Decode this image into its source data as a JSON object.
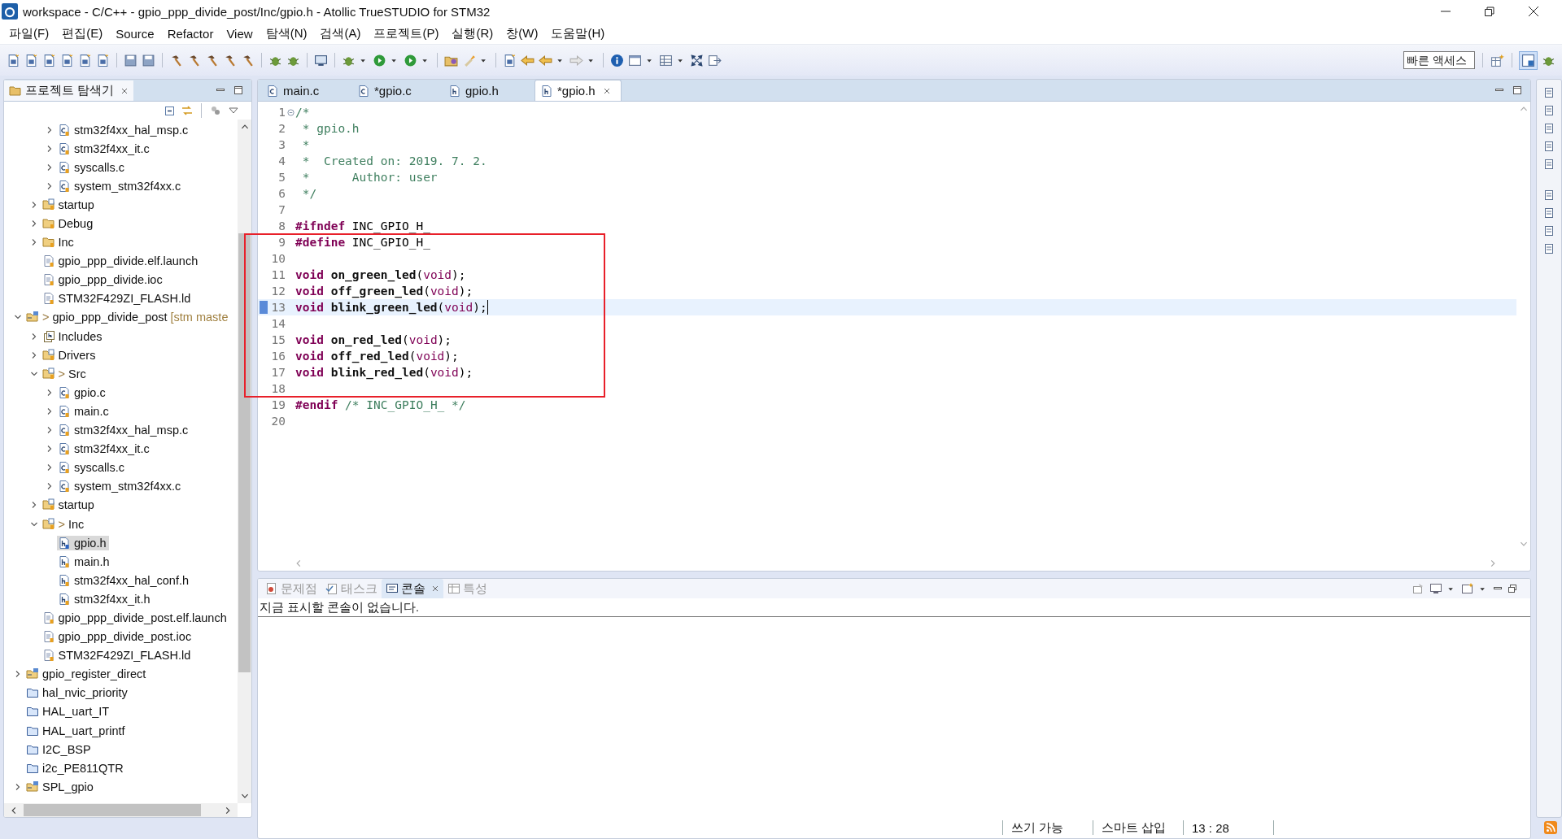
{
  "window": {
    "title": "workspace - C/C++ - gpio_ppp_divide_post/Inc/gpio.h - Atollic TrueSTUDIO for STM32"
  },
  "menu": [
    "파일(F)",
    "편집(E)",
    "Source",
    "Refactor",
    "View",
    "탐색(N)",
    "검색(A)",
    "프로젝트(P)",
    "실행(R)",
    "창(W)",
    "도움말(H)"
  ],
  "quick_access": {
    "placeholder": "빠른 액세스"
  },
  "explorer": {
    "title": "프로젝트 탐색기",
    "items": [
      {
        "children": [
          {
            "children": [
              {
                "label": "stm32f4xx_hal_msp.c",
                "kind": "c-file",
                "expanded": false,
                "selected": false
              },
              {
                "label": "stm32f4xx_it.c",
                "kind": "c-file",
                "expanded": false,
                "selected": false
              },
              {
                "label": "syscalls.c",
                "kind": "c-file",
                "expanded": false,
                "selected": false
              },
              {
                "label": "system_stm32f4xx.c",
                "kind": "c-file",
                "expanded": false,
                "selected": false
              }
            ]
          },
          {
            "label": "startup",
            "kind": "src-folder",
            "expanded": false,
            "selected": false
          },
          {
            "label": "Debug",
            "kind": "folder",
            "expanded": false,
            "selected": false
          },
          {
            "label": "Inc",
            "kind": "folder",
            "expanded": false,
            "selected": false
          },
          {
            "label": "gpio_ppp_divide.elf.launch",
            "kind": "doc-file",
            "selected": false
          },
          {
            "label": "gpio_ppp_divide.ioc",
            "kind": "doc-file",
            "selected": false
          },
          {
            "label": "STM32F429ZI_FLASH.ld",
            "kind": "doc-file",
            "selected": false
          }
        ]
      },
      {
        "label": "gpio_ppp_divide_post",
        "prefix": ">",
        "suffix": "[stm maste",
        "kind": "project",
        "expanded": true,
        "selected": false,
        "children": [
          {
            "label": "Includes",
            "kind": "includes",
            "expanded": false,
            "selected": false
          },
          {
            "label": "Drivers",
            "kind": "src-folder",
            "expanded": false,
            "selected": false
          },
          {
            "label": "Src",
            "prefix": ">",
            "kind": "src-folder",
            "expanded": true,
            "selected": false,
            "children": [
              {
                "label": "gpio.c",
                "kind": "c-file",
                "expanded": false,
                "selected": false
              },
              {
                "label": "main.c",
                "kind": "c-file",
                "expanded": false,
                "selected": false
              },
              {
                "label": "stm32f4xx_hal_msp.c",
                "kind": "c-file",
                "expanded": false,
                "selected": false
              },
              {
                "label": "stm32f4xx_it.c",
                "kind": "c-file",
                "expanded": false,
                "selected": false
              },
              {
                "label": "syscalls.c",
                "kind": "c-file",
                "expanded": false,
                "selected": false
              },
              {
                "label": "system_stm32f4xx.c",
                "kind": "c-file",
                "expanded": false,
                "selected": false
              }
            ]
          },
          {
            "label": "startup",
            "kind": "src-folder",
            "expanded": false,
            "selected": false
          },
          {
            "label": "Inc",
            "prefix": ">",
            "kind": "src-folder",
            "expanded": true,
            "selected": false,
            "children": [
              {
                "label": "gpio.h",
                "kind": "h-file",
                "selected": true
              },
              {
                "label": "main.h",
                "kind": "h-file",
                "selected": false
              },
              {
                "label": "stm32f4xx_hal_conf.h",
                "kind": "h-file",
                "selected": false
              },
              {
                "label": "stm32f4xx_it.h",
                "kind": "h-file",
                "selected": false
              }
            ]
          },
          {
            "label": "gpio_ppp_divide_post.elf.launch",
            "kind": "doc-file",
            "selected": false
          },
          {
            "label": "gpio_ppp_divide_post.ioc",
            "kind": "doc-file",
            "selected": false
          },
          {
            "label": "STM32F429ZI_FLASH.ld",
            "kind": "doc-file",
            "selected": false
          }
        ]
      },
      {
        "label": "gpio_register_direct",
        "kind": "project",
        "expanded": false,
        "selected": false
      },
      {
        "label": "hal_nvic_priority",
        "kind": "closed-project",
        "selected": false
      },
      {
        "label": "HAL_uart_IT",
        "kind": "closed-project",
        "selected": false
      },
      {
        "label": "HAL_uart_printf",
        "kind": "closed-project",
        "selected": false
      },
      {
        "label": "I2C_BSP",
        "kind": "closed-project",
        "selected": false
      },
      {
        "label": "i2c_PE811QTR",
        "kind": "closed-project",
        "selected": false
      },
      {
        "label": "SPL_gpio",
        "kind": "project",
        "expanded": false,
        "selected": false
      }
    ]
  },
  "editor": {
    "tabs": [
      {
        "label": "main.c",
        "kind": "c",
        "selected": false
      },
      {
        "label": "*gpio.c",
        "kind": "c",
        "selected": false
      },
      {
        "label": "gpio.h",
        "kind": "h",
        "selected": false
      },
      {
        "label": "*gpio.h",
        "kind": "h",
        "selected": true
      }
    ],
    "lines": [
      {
        "number": "1",
        "fold": true,
        "current": false,
        "tokens": [
          {
            "kind": "comment",
            "text": "/*"
          }
        ]
      },
      {
        "number": "2",
        "fold": false,
        "current": false,
        "tokens": [
          {
            "kind": "comment",
            "text": " * gpio.h"
          }
        ]
      },
      {
        "number": "3",
        "fold": false,
        "current": false,
        "tokens": [
          {
            "kind": "comment",
            "text": " *"
          }
        ]
      },
      {
        "number": "4",
        "fold": false,
        "current": false,
        "tokens": [
          {
            "kind": "comment",
            "text": " *  Created on: 2019. 7. 2."
          }
        ]
      },
      {
        "number": "5",
        "fold": false,
        "current": false,
        "tokens": [
          {
            "kind": "comment",
            "text": " *      Author: user"
          }
        ]
      },
      {
        "number": "6",
        "fold": false,
        "current": false,
        "tokens": [
          {
            "kind": "comment",
            "text": " */"
          }
        ]
      },
      {
        "number": "7",
        "fold": false,
        "current": false
      },
      {
        "number": "8",
        "fold": false,
        "current": false,
        "tokens": [
          {
            "kind": "keyword",
            "text": "#ifndef"
          },
          {
            "kind": "plain",
            "text": " INC_GPIO_H_"
          }
        ]
      },
      {
        "number": "9",
        "fold": false,
        "current": false,
        "tokens": [
          {
            "kind": "keyword",
            "text": "#define"
          },
          {
            "kind": "plain",
            "text": " INC_GPIO_H_"
          }
        ]
      },
      {
        "number": "10",
        "fold": false,
        "current": false
      },
      {
        "number": "11",
        "fold": false,
        "current": false,
        "tokens": [
          {
            "kind": "keyword",
            "text": "void"
          },
          {
            "kind": "function",
            "text": " on_green_led"
          },
          {
            "kind": "plain",
            "text": "("
          },
          {
            "kind": "type",
            "text": "void"
          },
          {
            "kind": "plain",
            "text": ");"
          }
        ]
      },
      {
        "number": "12",
        "fold": false,
        "current": false,
        "tokens": [
          {
            "kind": "keyword",
            "text": "void"
          },
          {
            "kind": "function",
            "text": " off_green_led"
          },
          {
            "kind": "plain",
            "text": "("
          },
          {
            "kind": "type",
            "text": "void"
          },
          {
            "kind": "plain",
            "text": ");"
          }
        ]
      },
      {
        "number": "13",
        "fold": false,
        "current": true,
        "tokens": [
          {
            "kind": "keyword",
            "text": "void"
          },
          {
            "kind": "function",
            "text": " blink_green_led"
          },
          {
            "kind": "plain",
            "text": "("
          },
          {
            "kind": "type",
            "text": "void"
          },
          {
            "kind": "plain",
            "text": ");"
          }
        ]
      },
      {
        "number": "14",
        "fold": false,
        "current": false
      },
      {
        "number": "15",
        "fold": false,
        "current": false,
        "tokens": [
          {
            "kind": "keyword",
            "text": "void"
          },
          {
            "kind": "function",
            "text": " on_red_led"
          },
          {
            "kind": "plain",
            "text": "("
          },
          {
            "kind": "type",
            "text": "void"
          },
          {
            "kind": "plain",
            "text": ");"
          }
        ]
      },
      {
        "number": "16",
        "fold": false,
        "current": false,
        "tokens": [
          {
            "kind": "keyword",
            "text": "void"
          },
          {
            "kind": "function",
            "text": " off_red_led"
          },
          {
            "kind": "plain",
            "text": "("
          },
          {
            "kind": "type",
            "text": "void"
          },
          {
            "kind": "plain",
            "text": ");"
          }
        ]
      },
      {
        "number": "17",
        "fold": false,
        "current": false,
        "tokens": [
          {
            "kind": "keyword",
            "text": "void"
          },
          {
            "kind": "function",
            "text": " blink_red_led"
          },
          {
            "kind": "plain",
            "text": "("
          },
          {
            "kind": "type",
            "text": "void"
          },
          {
            "kind": "plain",
            "text": ");"
          }
        ]
      },
      {
        "number": "18",
        "fold": false,
        "current": false
      },
      {
        "number": "19",
        "fold": false,
        "current": false,
        "tokens": [
          {
            "kind": "keyword",
            "text": "#endif"
          },
          {
            "kind": "comment",
            "text": " /* INC_GPIO_H_ */"
          }
        ]
      },
      {
        "number": "20",
        "fold": false,
        "current": false
      }
    ]
  },
  "console": {
    "tabs": [
      {
        "label": "문제점",
        "kind": "problems",
        "selected": false
      },
      {
        "label": "태스크",
        "kind": "tasks",
        "selected": false
      },
      {
        "label": "콘솔",
        "kind": "console",
        "selected": true
      },
      {
        "label": "특성",
        "kind": "properties",
        "selected": false
      }
    ],
    "message": "지금 표시할 콘솔이 없습니다."
  },
  "status_bar": [
    "쓰기 가능",
    "스마트 삽입",
    "13 : 28"
  ]
}
